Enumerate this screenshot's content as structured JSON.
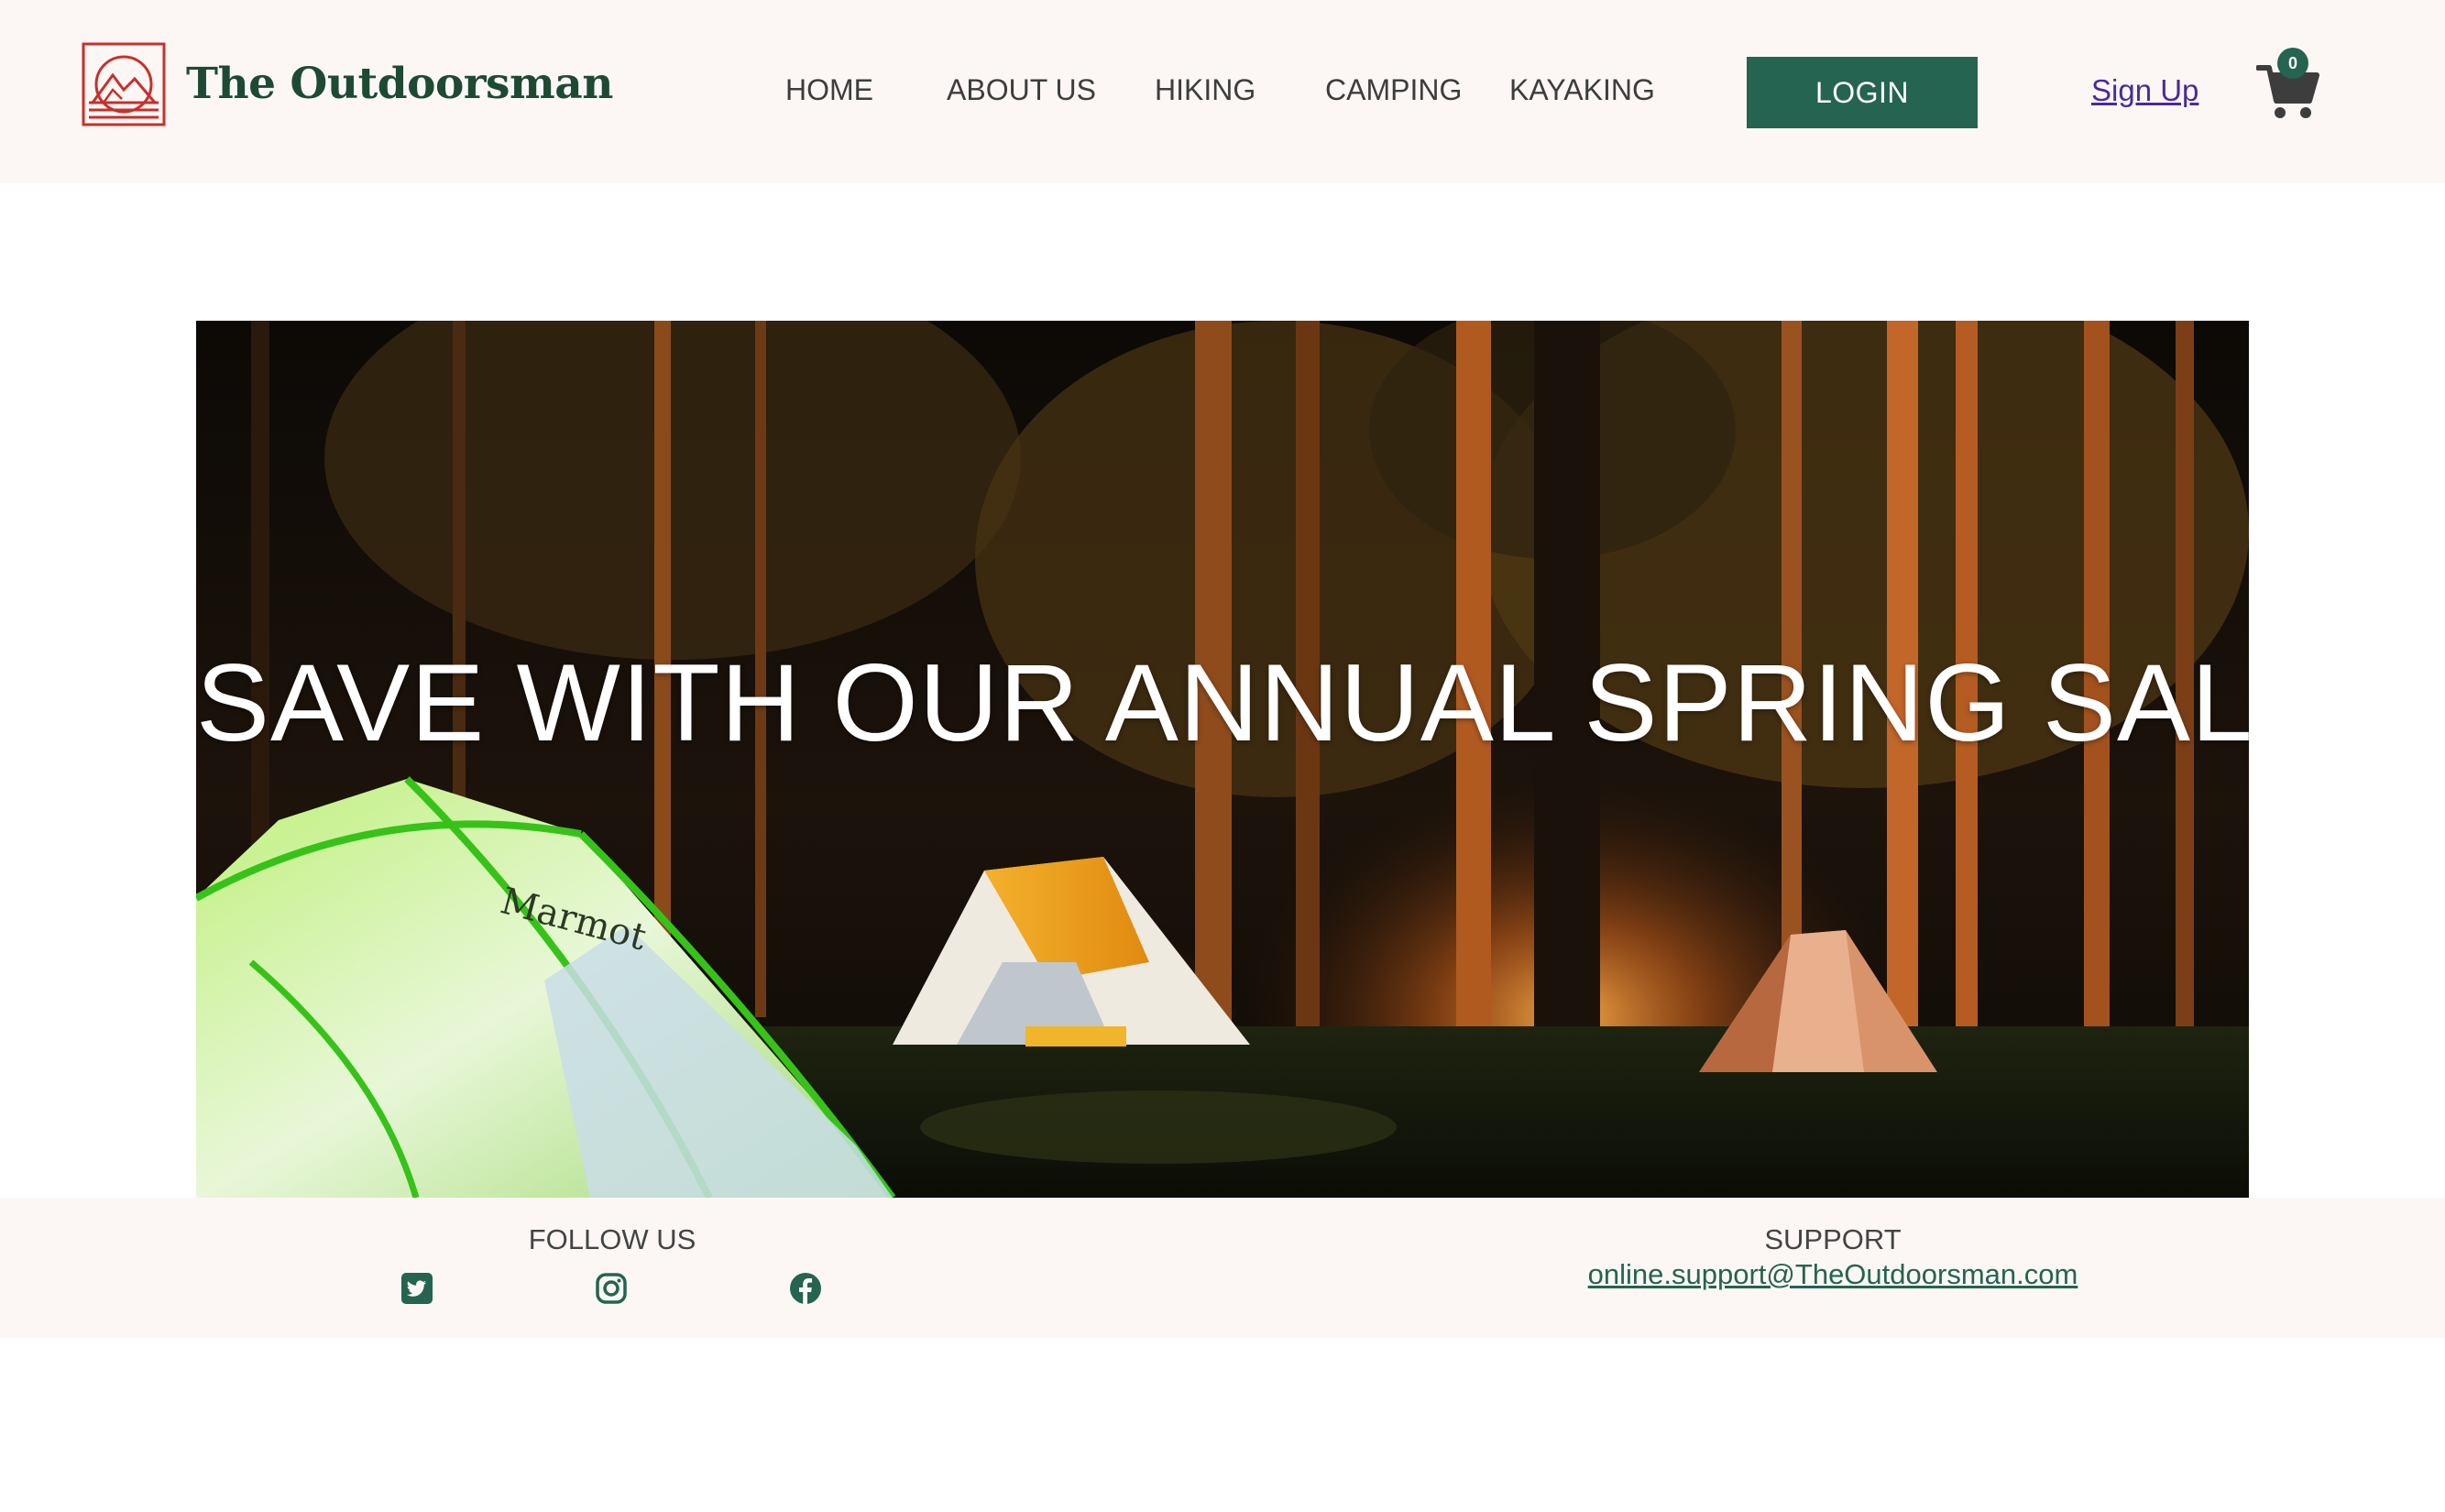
{
  "brand": {
    "name": "The Outdoorsman",
    "logo_icon": "mountain-sun-logo-icon",
    "logo_color": "#c8302a",
    "text_color": "#1e4a33"
  },
  "nav": {
    "items": [
      {
        "label": "HOME"
      },
      {
        "label": "ABOUT US"
      },
      {
        "label": "HIKING"
      },
      {
        "label": "CAMPING"
      },
      {
        "label": "KAYAKING"
      }
    ]
  },
  "header": {
    "login_label": "LOGIN",
    "signup_label": "Sign Up",
    "cart_icon": "shopping-cart-icon",
    "cart_count": "0",
    "accent_color": "#246451"
  },
  "hero": {
    "headline": "SAVE WITH OUR ANNUAL SPRING SALE",
    "tent_brand": "Marmot"
  },
  "footer": {
    "follow_title": "FOLLOW US",
    "social_icons": [
      "twitter-icon",
      "instagram-icon",
      "facebook-icon"
    ],
    "support_title": "SUPPORT",
    "support_email": "online.support@TheOutdoorsman.com"
  }
}
